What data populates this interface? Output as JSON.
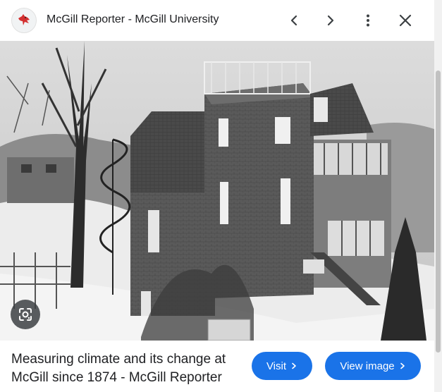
{
  "header": {
    "source_title": "McGill Reporter - McGill University",
    "favicon_icon": "cardinal-bird-icon",
    "buttons": [
      "back-icon",
      "forward-icon",
      "more-vert-icon",
      "close-icon"
    ]
  },
  "image": {
    "subject": "photo",
    "lens_icon": "google-lens-icon"
  },
  "footer": {
    "caption": "Measuring climate and its change at McGill since 1874 - McGill Reporter",
    "visit_label": "Visit",
    "view_image_label": "View image"
  },
  "colors": {
    "accent": "#1a73e8",
    "favicon_red": "#d32f2f"
  }
}
